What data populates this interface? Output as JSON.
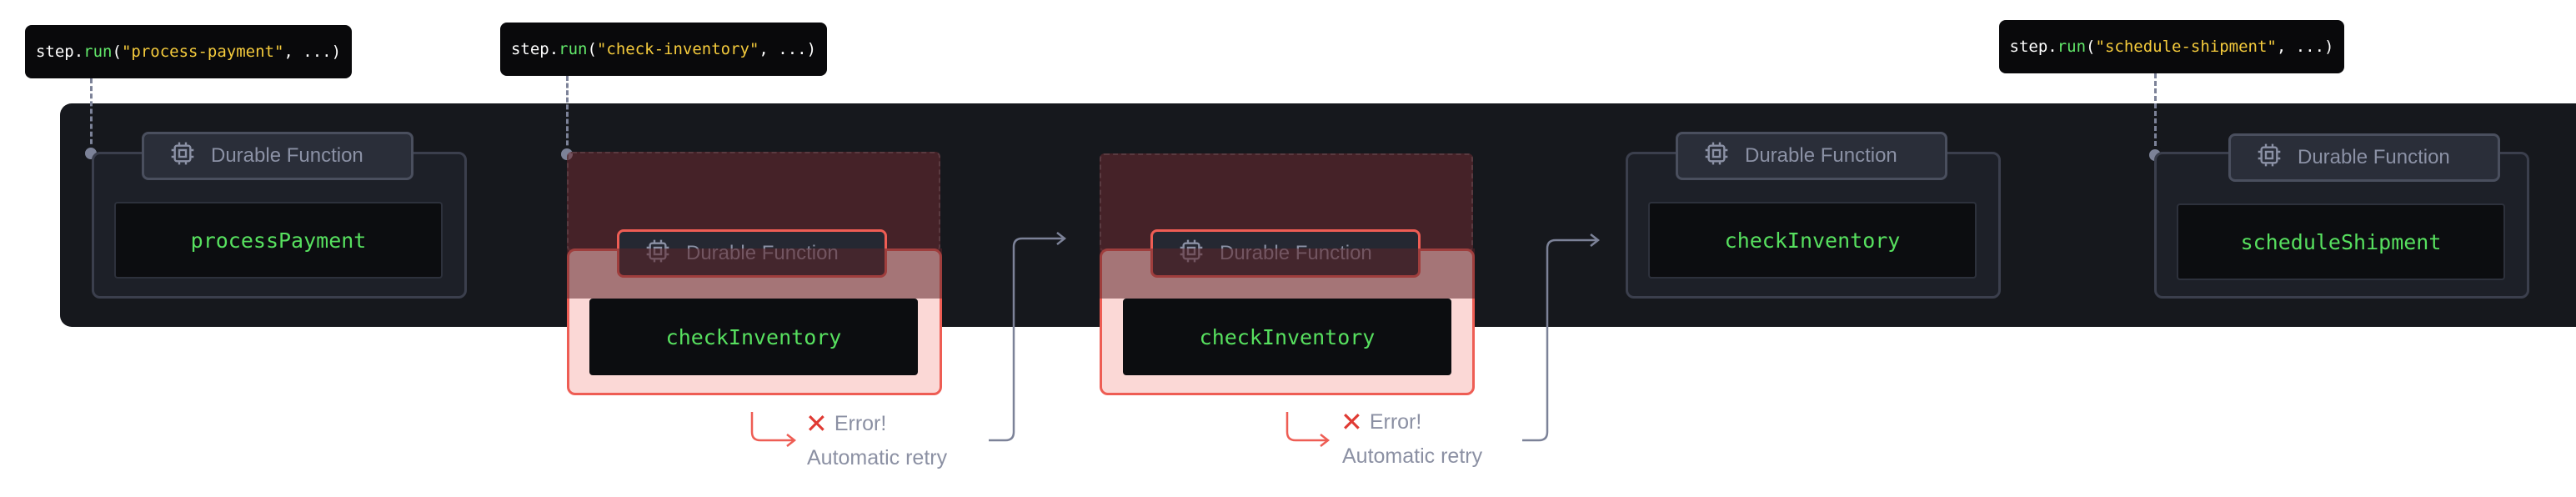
{
  "steps": [
    {
      "prefix": "step.",
      "method": "run",
      "open": "(",
      "name": "\"process-payment\"",
      "rest": ", ...)"
    },
    {
      "prefix": "step.",
      "method": "run",
      "open": "(",
      "name": "\"check-inventory\"",
      "rest": ", ...)"
    },
    {
      "prefix": "step.",
      "method": "run",
      "open": "(",
      "name": "\"schedule-shipment\"",
      "rest": ", ...)"
    }
  ],
  "card_header_label": "Durable Function",
  "functions": {
    "f1": "processPayment",
    "f2": "checkInventory",
    "f3": "checkInventory",
    "f4": "checkInventory",
    "f5": "scheduleShipment"
  },
  "retry": {
    "error_label": "Error!",
    "retry_label": "Automatic retry",
    "error_icon": "x-icon"
  },
  "colors": {
    "band": "#16181d",
    "function_text": "#57e05f",
    "error_accent": "#ee5d54",
    "error_fill": "#fbd8d6",
    "muted_text": "#8b90a3"
  }
}
